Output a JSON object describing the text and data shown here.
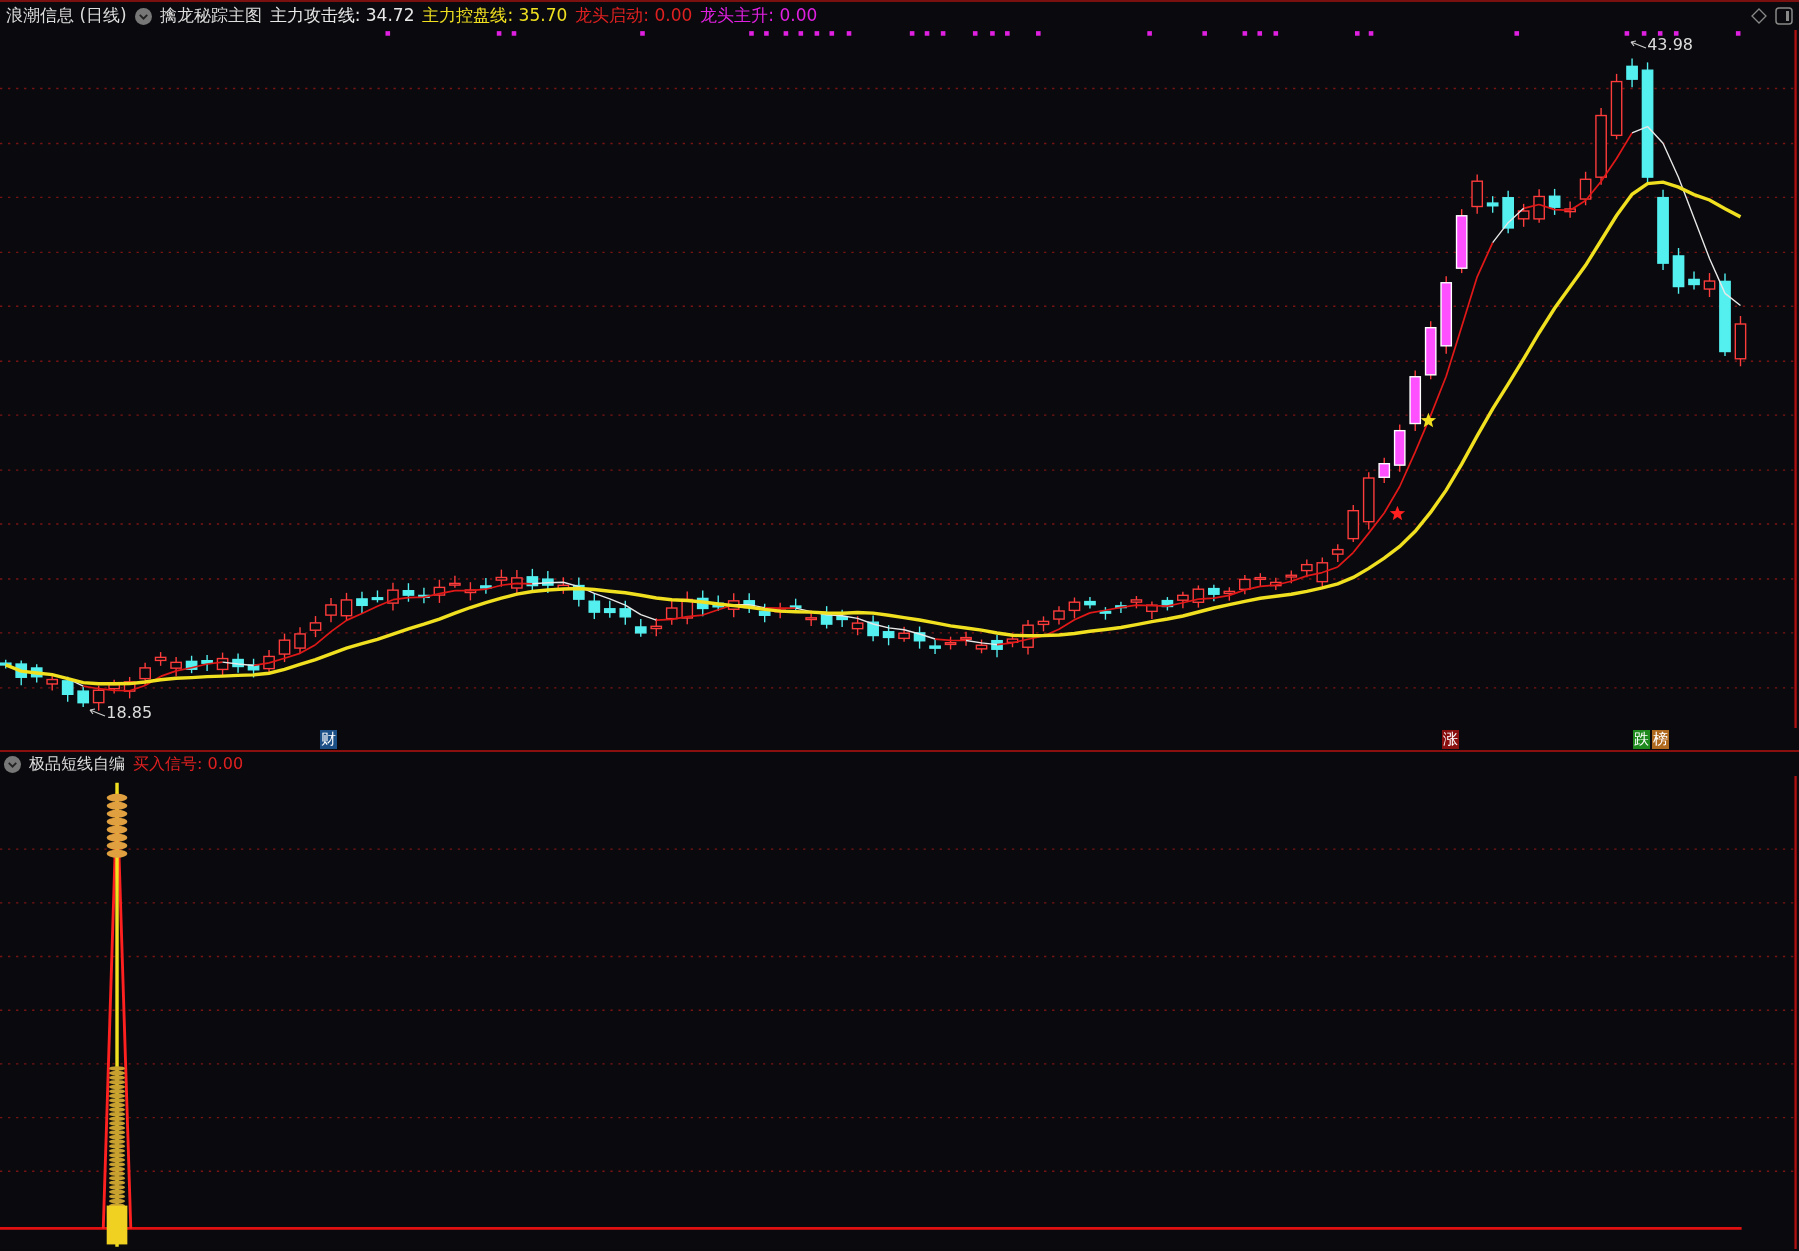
{
  "header": {
    "stock": "浪潮信息 (日线)",
    "indicator": "擒龙秘踪主图",
    "values": [
      {
        "text": "主力攻击线: 34.72",
        "color": "#e8e8e8"
      },
      {
        "text": "主力控盘线: 35.70",
        "color": "#f0e020"
      },
      {
        "text": "龙头启动: 0.00",
        "color": "#e02020"
      },
      {
        "text": "龙头主升: 0.00",
        "color": "#e020e0"
      }
    ]
  },
  "price_labels": [
    {
      "text": "43.98"
    },
    {
      "text": "18.85"
    }
  ],
  "markers": [
    {
      "text": "财",
      "color": "#1c4f86"
    },
    {
      "text": "涨",
      "color": "#8a1010"
    },
    {
      "text": "跌",
      "color": "#1e8a1e"
    },
    {
      "text": "榜",
      "color": "#b06a20"
    }
  ],
  "sub_panel": {
    "indicator": "极品短线自编",
    "values": [
      {
        "text": "买入信号: 0.00",
        "color": "#e02020"
      }
    ]
  }
}
